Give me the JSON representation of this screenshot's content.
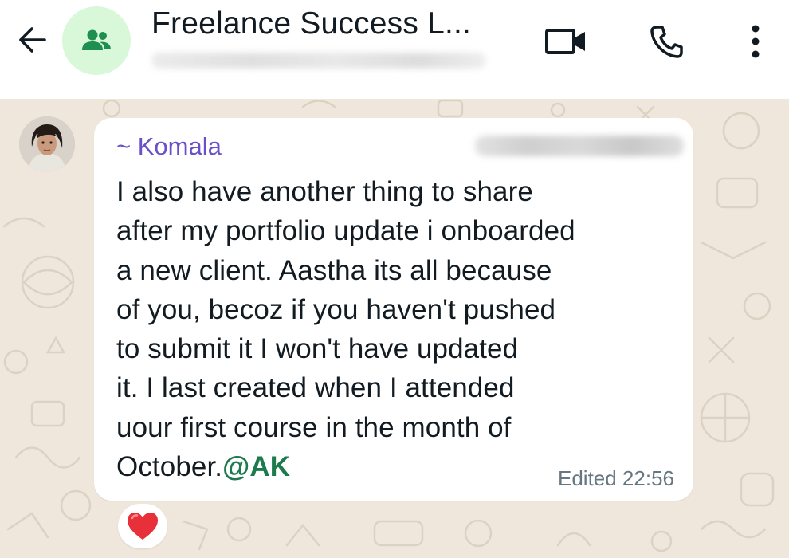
{
  "header": {
    "title": "Freelance Success L...",
    "icons": {
      "back": "arrow-left-icon",
      "group": "group-icon",
      "video": "video-camera-icon",
      "call": "phone-icon",
      "menu": "more-vertical-icon"
    }
  },
  "message": {
    "sender": "~ Komala",
    "text": "I also have another thing to share\nafter my portfolio update i onboarded\na new client. Aastha its all because\nof you, becoz if you haven't pushed\nto submit it I won't have updated\nit. I last created when I attended\nuour first course in the month of\nOctober.",
    "mention": "@AK",
    "meta": "Edited 22:56",
    "reaction": "heart-emoji"
  },
  "colors": {
    "chat_background": "#efe7dc",
    "sender_name": "#6a4fc8",
    "mention": "#1c7a4c",
    "header_icon": "#111b21",
    "group_avatar_bg": "#d9f7d9",
    "group_icon": "#1f8f4f"
  }
}
